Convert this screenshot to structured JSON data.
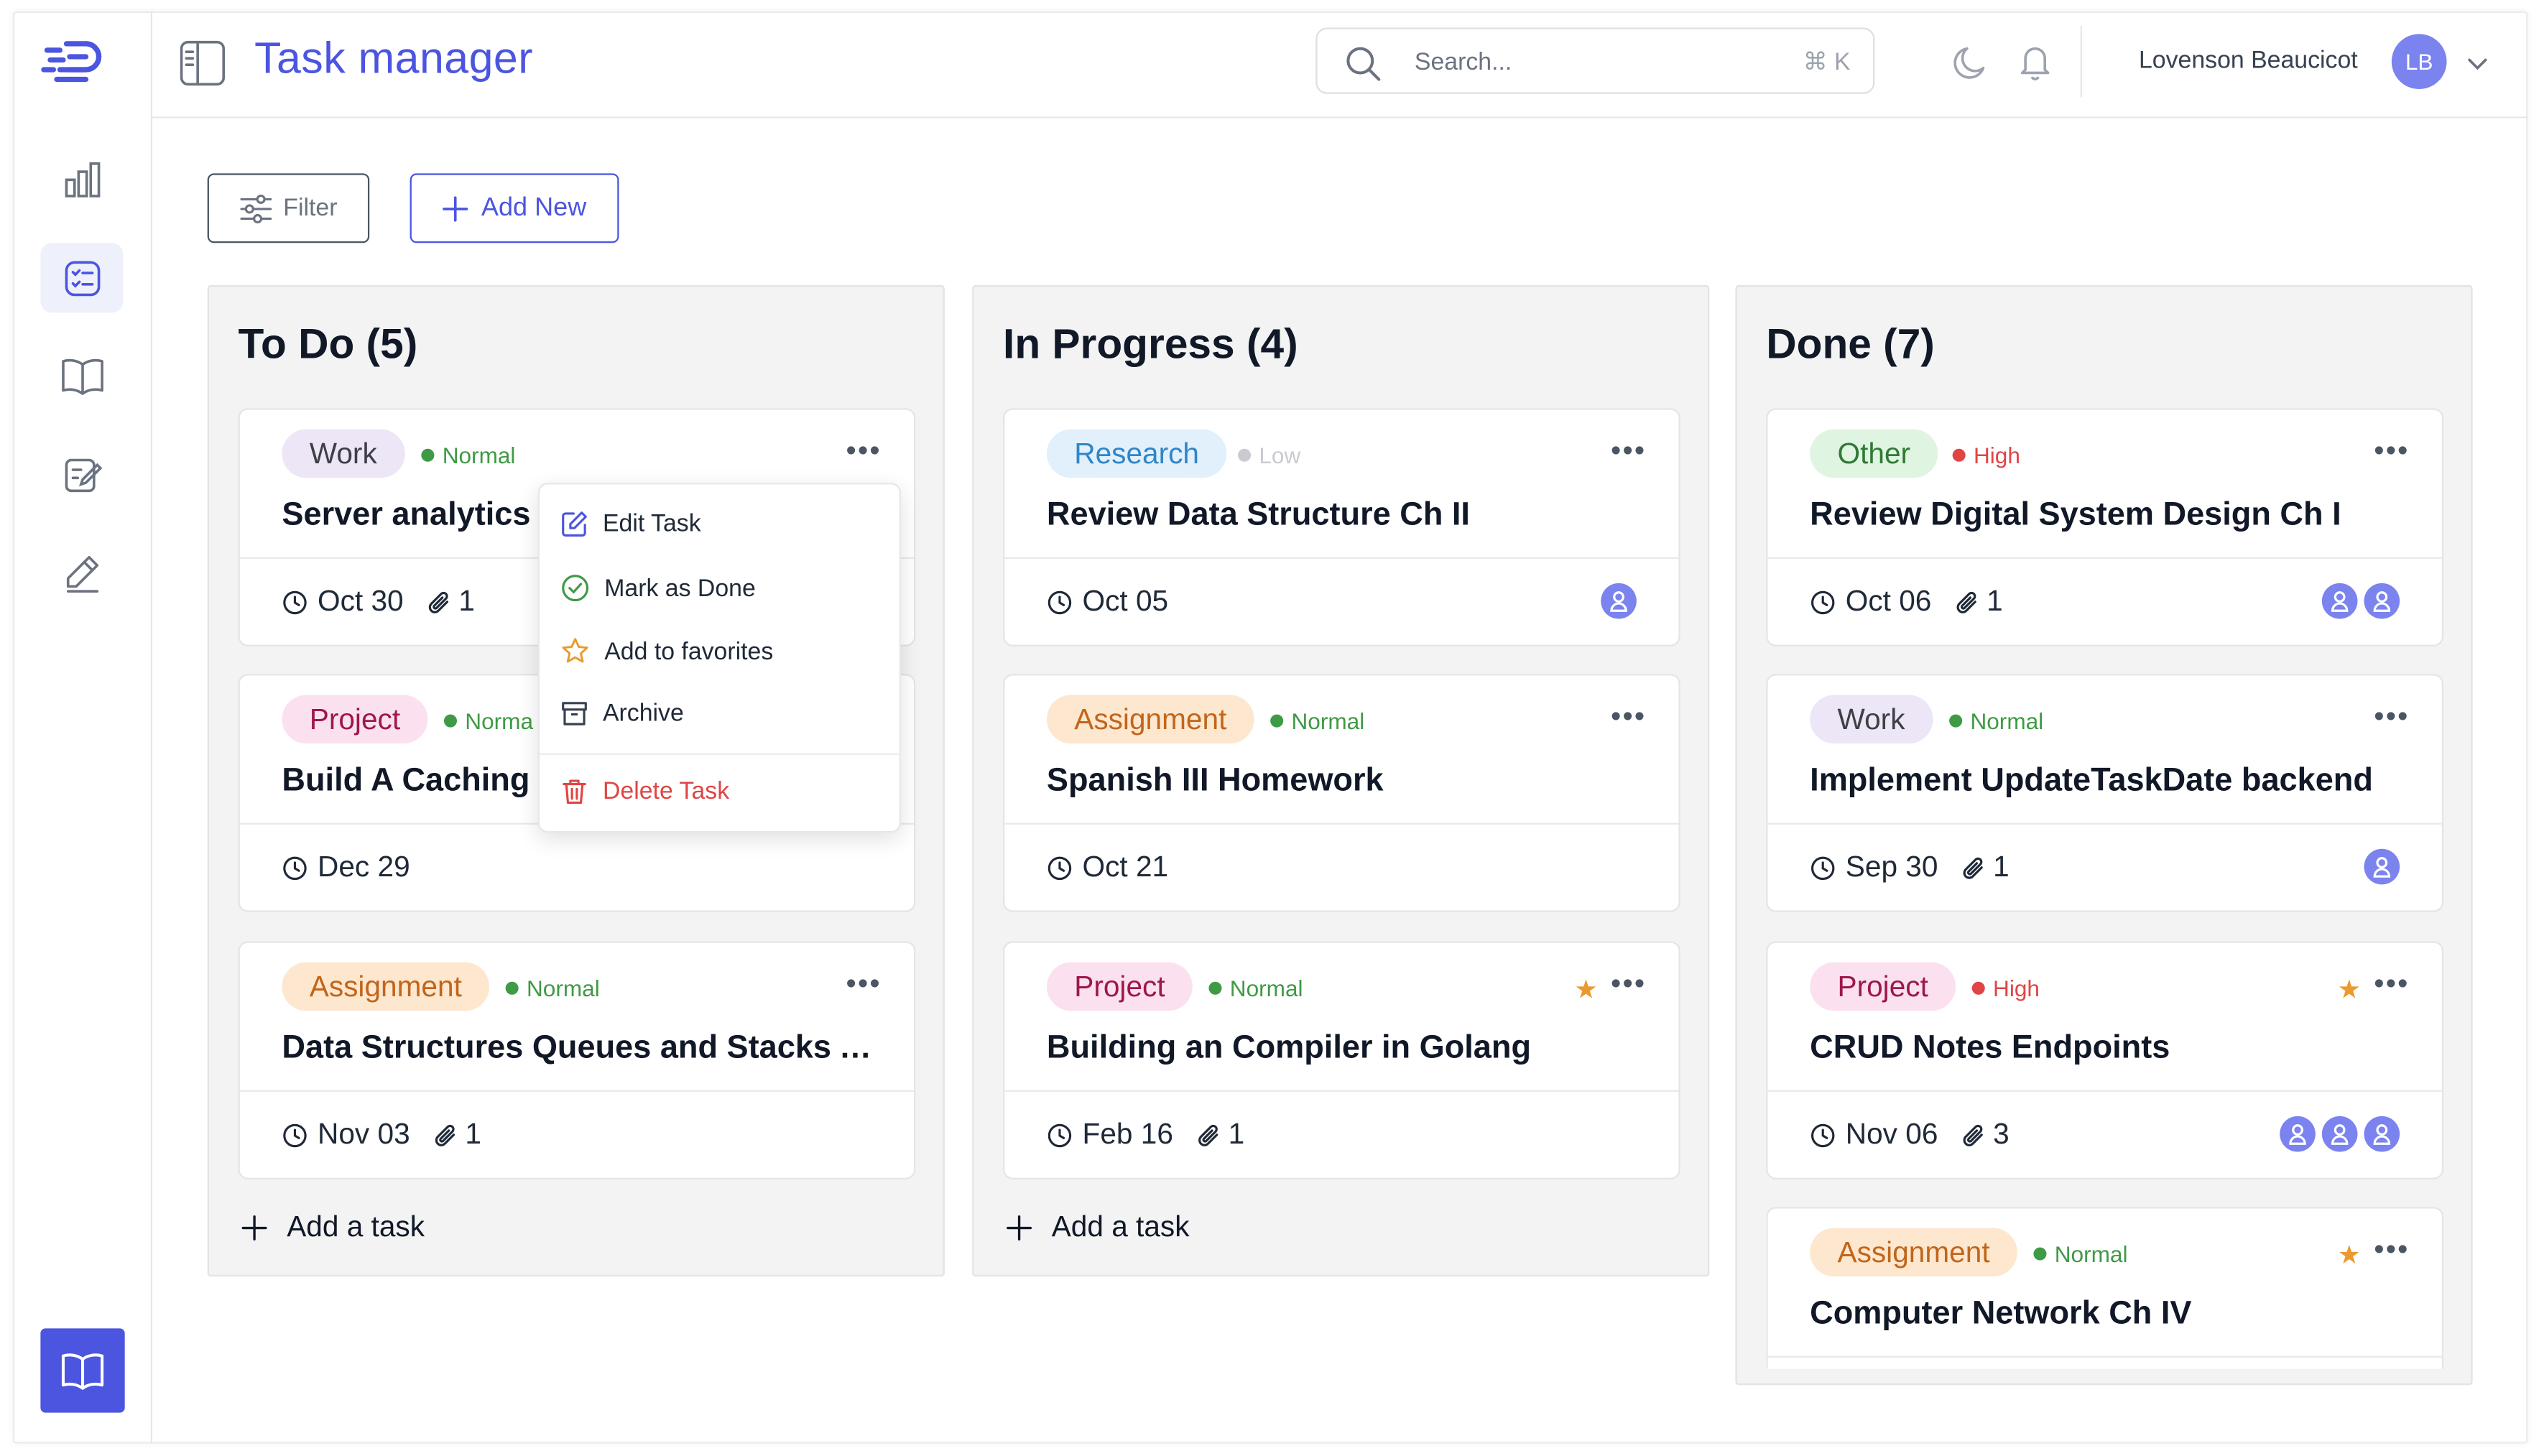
{
  "app": {
    "title": "Task manager",
    "brand_color": "#4b55e0"
  },
  "search": {
    "placeholder": "Search...",
    "shortcut": "⌘ K"
  },
  "user": {
    "name": "Lovenson Beaucicot",
    "initials": "LB"
  },
  "sidebar": {
    "items": [
      {
        "icon": "bar-chart-icon",
        "active": false
      },
      {
        "icon": "task-list-icon",
        "active": true
      },
      {
        "icon": "book-icon",
        "active": false
      },
      {
        "icon": "note-edit-icon",
        "active": false
      },
      {
        "icon": "pencil-icon",
        "active": false
      }
    ],
    "bottom_icon": "book-icon"
  },
  "toolbar": {
    "filter_label": "Filter",
    "add_new_label": "Add New"
  },
  "tag_colors": {
    "Work": {
      "bg": "#ece6f7",
      "fg": "#3f3f46"
    },
    "Project": {
      "bg": "#fbe1ef",
      "fg": "#9d174d"
    },
    "Assignment": {
      "bg": "#fde7cf",
      "fg": "#c2651b"
    },
    "Research": {
      "bg": "#e1f0fb",
      "fg": "#2f86c8"
    },
    "Other": {
      "bg": "#e0f5e1",
      "fg": "#2f7a36"
    }
  },
  "priority_colors": {
    "Normal": "#3f9a45",
    "Low": "#c9cbd0",
    "High": "#e04545"
  },
  "columns": [
    {
      "title": "To Do (5)",
      "add_task_label": "Add a task",
      "cards": [
        {
          "tag": "Work",
          "priority": "Normal",
          "title": "Server analytics s",
          "date": "Oct 30",
          "attachments": "1",
          "people": 0,
          "starred": false
        },
        {
          "tag": "Project",
          "priority": "Norma",
          "title": "Build A Caching F",
          "date": "Dec 29",
          "attachments": "",
          "people": 0,
          "starred": false
        },
        {
          "tag": "Assignment",
          "priority": "Normal",
          "title": "Data Structures Queues and Stacks A...",
          "date": "Nov 03",
          "attachments": "1",
          "people": 0,
          "starred": false
        }
      ]
    },
    {
      "title": "In Progress (4)",
      "add_task_label": "Add a task",
      "cards": [
        {
          "tag": "Research",
          "priority": "Low",
          "title": "Review Data Structure Ch II",
          "date": "Oct 05",
          "attachments": "",
          "people": 1,
          "starred": false
        },
        {
          "tag": "Assignment",
          "priority": "Normal",
          "title": "Spanish III Homework",
          "date": "Oct 21",
          "attachments": "",
          "people": 0,
          "starred": false
        },
        {
          "tag": "Project",
          "priority": "Normal",
          "title": "Building an Compiler in Golang",
          "date": "Feb 16",
          "attachments": "1",
          "people": 0,
          "starred": true
        }
      ]
    },
    {
      "title": "Done (7)",
      "add_task_label": "",
      "cards": [
        {
          "tag": "Other",
          "priority": "High",
          "title": "Review Digital System Design Ch I",
          "date": "Oct 06",
          "attachments": "1",
          "people": 2,
          "starred": false
        },
        {
          "tag": "Work",
          "priority": "Normal",
          "title": "Implement UpdateTaskDate backend",
          "date": "Sep 30",
          "attachments": "1",
          "people": 1,
          "starred": false
        },
        {
          "tag": "Project",
          "priority": "High",
          "title": "CRUD Notes Endpoints",
          "date": "Nov 06",
          "attachments": "3",
          "people": 3,
          "starred": true
        },
        {
          "tag": "Assignment",
          "priority": "Normal",
          "title": "Computer Network Ch IV",
          "date": "",
          "attachments": "",
          "people": 0,
          "starred": true
        }
      ]
    }
  ],
  "context_menu": {
    "items": [
      {
        "label": "Edit Task",
        "icon": "edit-icon",
        "danger": false
      },
      {
        "label": "Mark as Done",
        "icon": "check-circle-icon",
        "danger": false
      },
      {
        "label": "Add to favorites",
        "icon": "star-icon",
        "danger": false
      },
      {
        "label": "Archive",
        "icon": "archive-icon",
        "danger": false
      },
      {
        "label": "Delete Task",
        "icon": "trash-icon",
        "danger": true
      }
    ]
  }
}
